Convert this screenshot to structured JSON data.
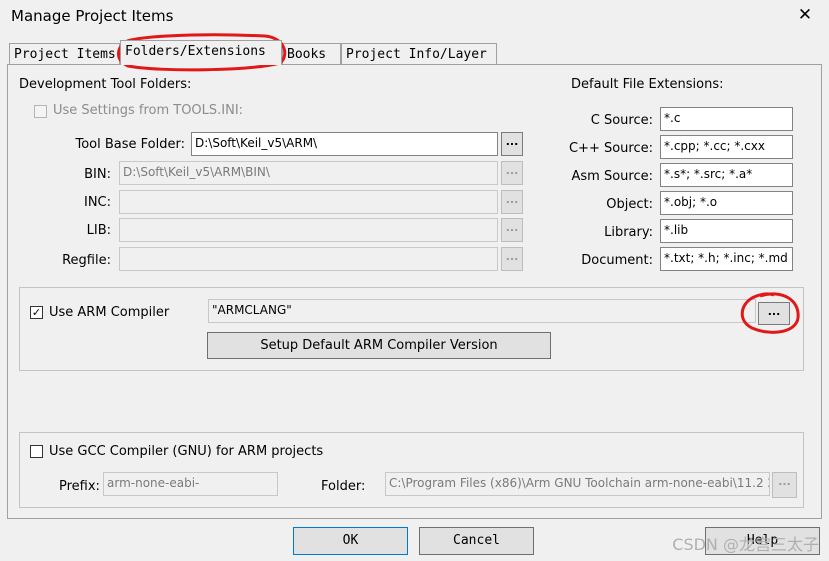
{
  "window": {
    "title": "Manage Project Items",
    "close_glyph": "✕"
  },
  "tabs": [
    {
      "label": "Project Items",
      "active": false
    },
    {
      "label": "Folders/Extensions",
      "active": true
    },
    {
      "label": "Books",
      "active": false
    },
    {
      "label": "Project Info/Layer",
      "active": false
    }
  ],
  "folders": {
    "section_title": "Development Tool Folders:",
    "use_tools_ini": {
      "label": "Use Settings from TOOLS.INI:",
      "checked": false,
      "enabled": false
    },
    "tool_base": {
      "label": "Tool Base Folder:",
      "value": "D:\\Soft\\Keil_v5\\ARM\\"
    },
    "bin": {
      "label": "BIN:",
      "value": "D:\\Soft\\Keil_v5\\ARM\\BIN\\"
    },
    "inc": {
      "label": "INC:",
      "value": ""
    },
    "lib": {
      "label": "LIB:",
      "value": ""
    },
    "regfile": {
      "label": "Regfile:",
      "value": ""
    },
    "browse_label": "..."
  },
  "extensions": {
    "section_title": "Default File Extensions:",
    "c_source": {
      "label": "C Source:",
      "value": "*.c"
    },
    "cpp_source": {
      "label": "C++ Source:",
      "value": "*.cpp; *.cc; *.cxx"
    },
    "asm_source": {
      "label": "Asm Source:",
      "value": "*.s*; *.src; *.a*"
    },
    "object": {
      "label": "Object:",
      "value": "*.obj; *.o"
    },
    "library": {
      "label": "Library:",
      "value": "*.lib"
    },
    "document": {
      "label": "Document:",
      "value": "*.txt; *.h; *.inc; *.md"
    }
  },
  "arm_compiler": {
    "label": "Use ARM Compiler",
    "checked": true,
    "check_glyph": "✓",
    "value": "\"ARMCLANG\"",
    "browse_label": "...",
    "setup_button": "Setup Default ARM Compiler Version"
  },
  "gcc": {
    "label": "Use GCC Compiler (GNU) for ARM projects",
    "checked": false,
    "prefix_label": "Prefix:",
    "prefix_value": "arm-none-eabi-",
    "folder_label": "Folder:",
    "folder_value": "C:\\Program Files (x86)\\Arm GNU Toolchain arm-none-eabi\\11.2 2",
    "browse_label": "..."
  },
  "buttons": {
    "ok": "OK",
    "cancel": "Cancel",
    "help": "Help"
  },
  "watermark": "CSDN @龙宫三太子",
  "colors": {
    "annotation_red": "#e01818",
    "window_bg": "#f0f0f0",
    "field_border": "#828282"
  }
}
